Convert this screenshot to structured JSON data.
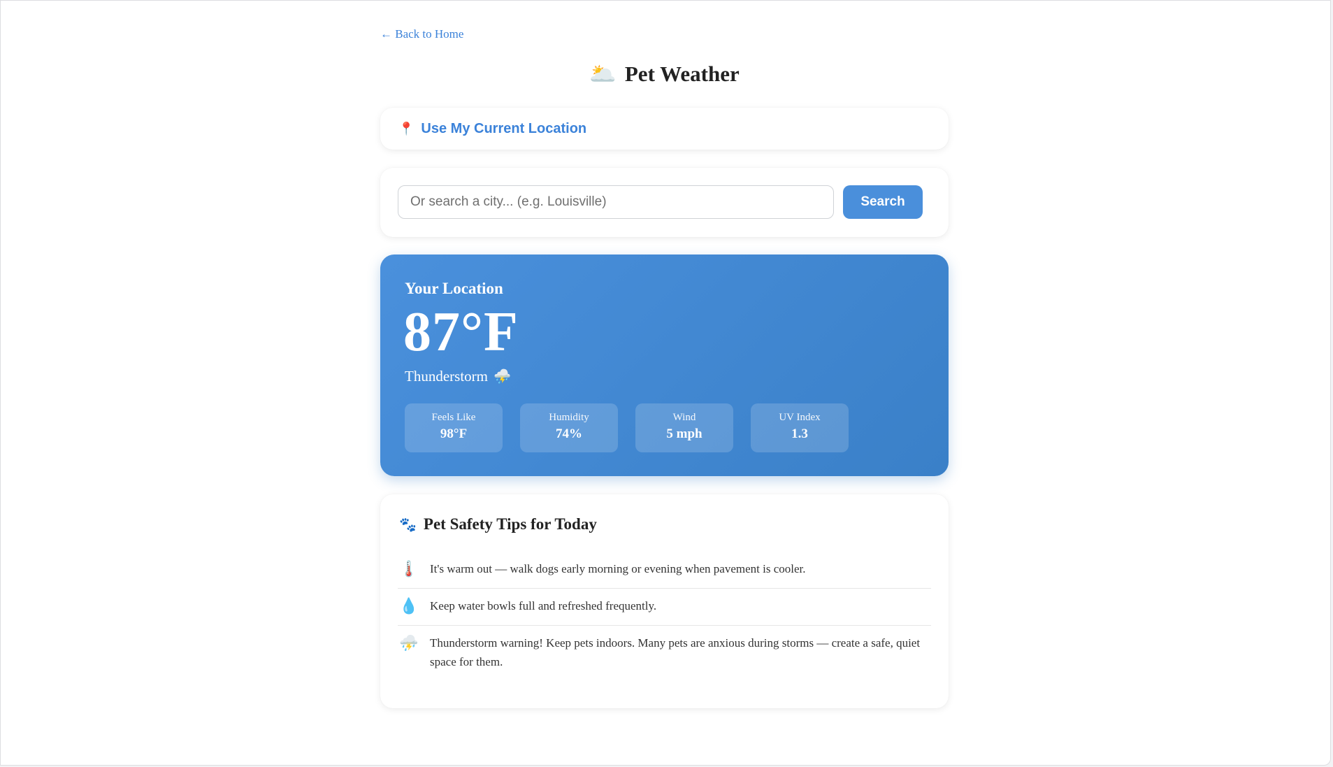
{
  "nav": {
    "back_label": "← Back to Home"
  },
  "header": {
    "title": "Pet Weather",
    "title_icon": "🌥️"
  },
  "location_button": {
    "icon": "📍",
    "label": "Use My Current Location"
  },
  "search": {
    "placeholder": "Or search a city... (e.g. Louisville)",
    "value": "",
    "button_label": "Search"
  },
  "weather": {
    "location": "Your Location",
    "temperature": "87°F",
    "condition": "Thunderstorm",
    "condition_icon": "⛈️",
    "stats": [
      {
        "label": "Feels Like",
        "value": "98°F"
      },
      {
        "label": "Humidity",
        "value": "74%"
      },
      {
        "label": "Wind",
        "value": "5 mph"
      },
      {
        "label": "UV Index",
        "value": "1.3"
      }
    ]
  },
  "tips": {
    "title": "Pet Safety Tips for Today",
    "title_icon": "🐾",
    "items": [
      {
        "icon": "🌡️",
        "text": "It's warm out — walk dogs early morning or evening when pavement is cooler."
      },
      {
        "icon": "💧",
        "text": "Keep water bowls full and refreshed frequently."
      },
      {
        "icon": "⛈️",
        "text": "Thunderstorm warning! Keep pets indoors. Many pets are anxious during storms — create a safe, quiet space for them."
      }
    ]
  },
  "colors": {
    "accent": "#3b82d9",
    "button": "#4a8fdb",
    "weather_card_start": "#4a90dc",
    "weather_card_end": "#3a80c8"
  }
}
